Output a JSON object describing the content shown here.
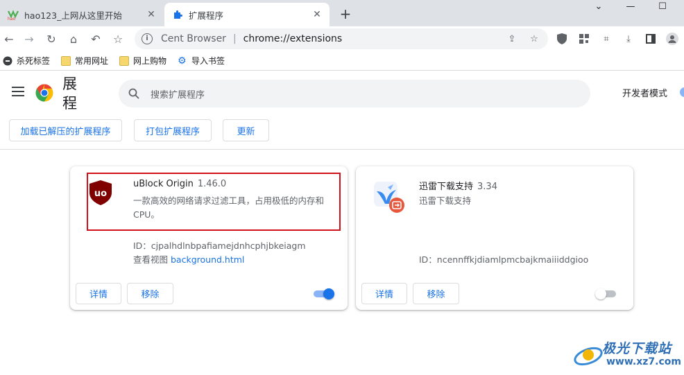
{
  "tabs": [
    {
      "title": "hao123_上网从这里开始",
      "favicon": "hao123-icon",
      "active": false
    },
    {
      "title": "扩展程序",
      "favicon": "puzzle-icon",
      "active": true
    }
  ],
  "toolbar": {
    "browser_name": "Cent Browser",
    "url": "chrome://extensions"
  },
  "bookmarks": [
    {
      "label": "杀死标签",
      "icon": "kill-tab-icon"
    },
    {
      "label": "常用网址",
      "icon": "folder-icon"
    },
    {
      "label": "网上购物",
      "icon": "folder-icon"
    },
    {
      "label": "导入书签",
      "icon": "gear-icon"
    }
  ],
  "header": {
    "title": "展程",
    "search_placeholder": "搜索扩展程序",
    "dev_mode_label": "开发者模式"
  },
  "actions": {
    "load_unpacked": "加载已解压的扩展程序",
    "pack": "打包扩展程序",
    "update": "更新"
  },
  "extensions": [
    {
      "name": "uBlock Origin",
      "version": "1.46.0",
      "description": "一款高效的网络请求过滤工具，占用极低的内存和CPU。",
      "id_text": "ID：cjpalhdlnbpafiamejdnhcphjbkeiagm",
      "inspect_label": "查看视图",
      "inspect_link": "background.html",
      "details_label": "详情",
      "remove_label": "移除",
      "enabled": true
    },
    {
      "name": "迅雷下载支持",
      "version": "3.34",
      "description": "迅雷下载支持",
      "id_text": "ID：ncennffkjdiamlpmcbajkmaiiiddgioo",
      "details_label": "详情",
      "remove_label": "移除",
      "enabled": false
    }
  ],
  "watermark": {
    "title": "极光下载站",
    "url": "www.xz7.com"
  },
  "colors": {
    "accent": "#1a73e8",
    "highlight_box": "#d0101a",
    "ublock_red": "#800000"
  }
}
